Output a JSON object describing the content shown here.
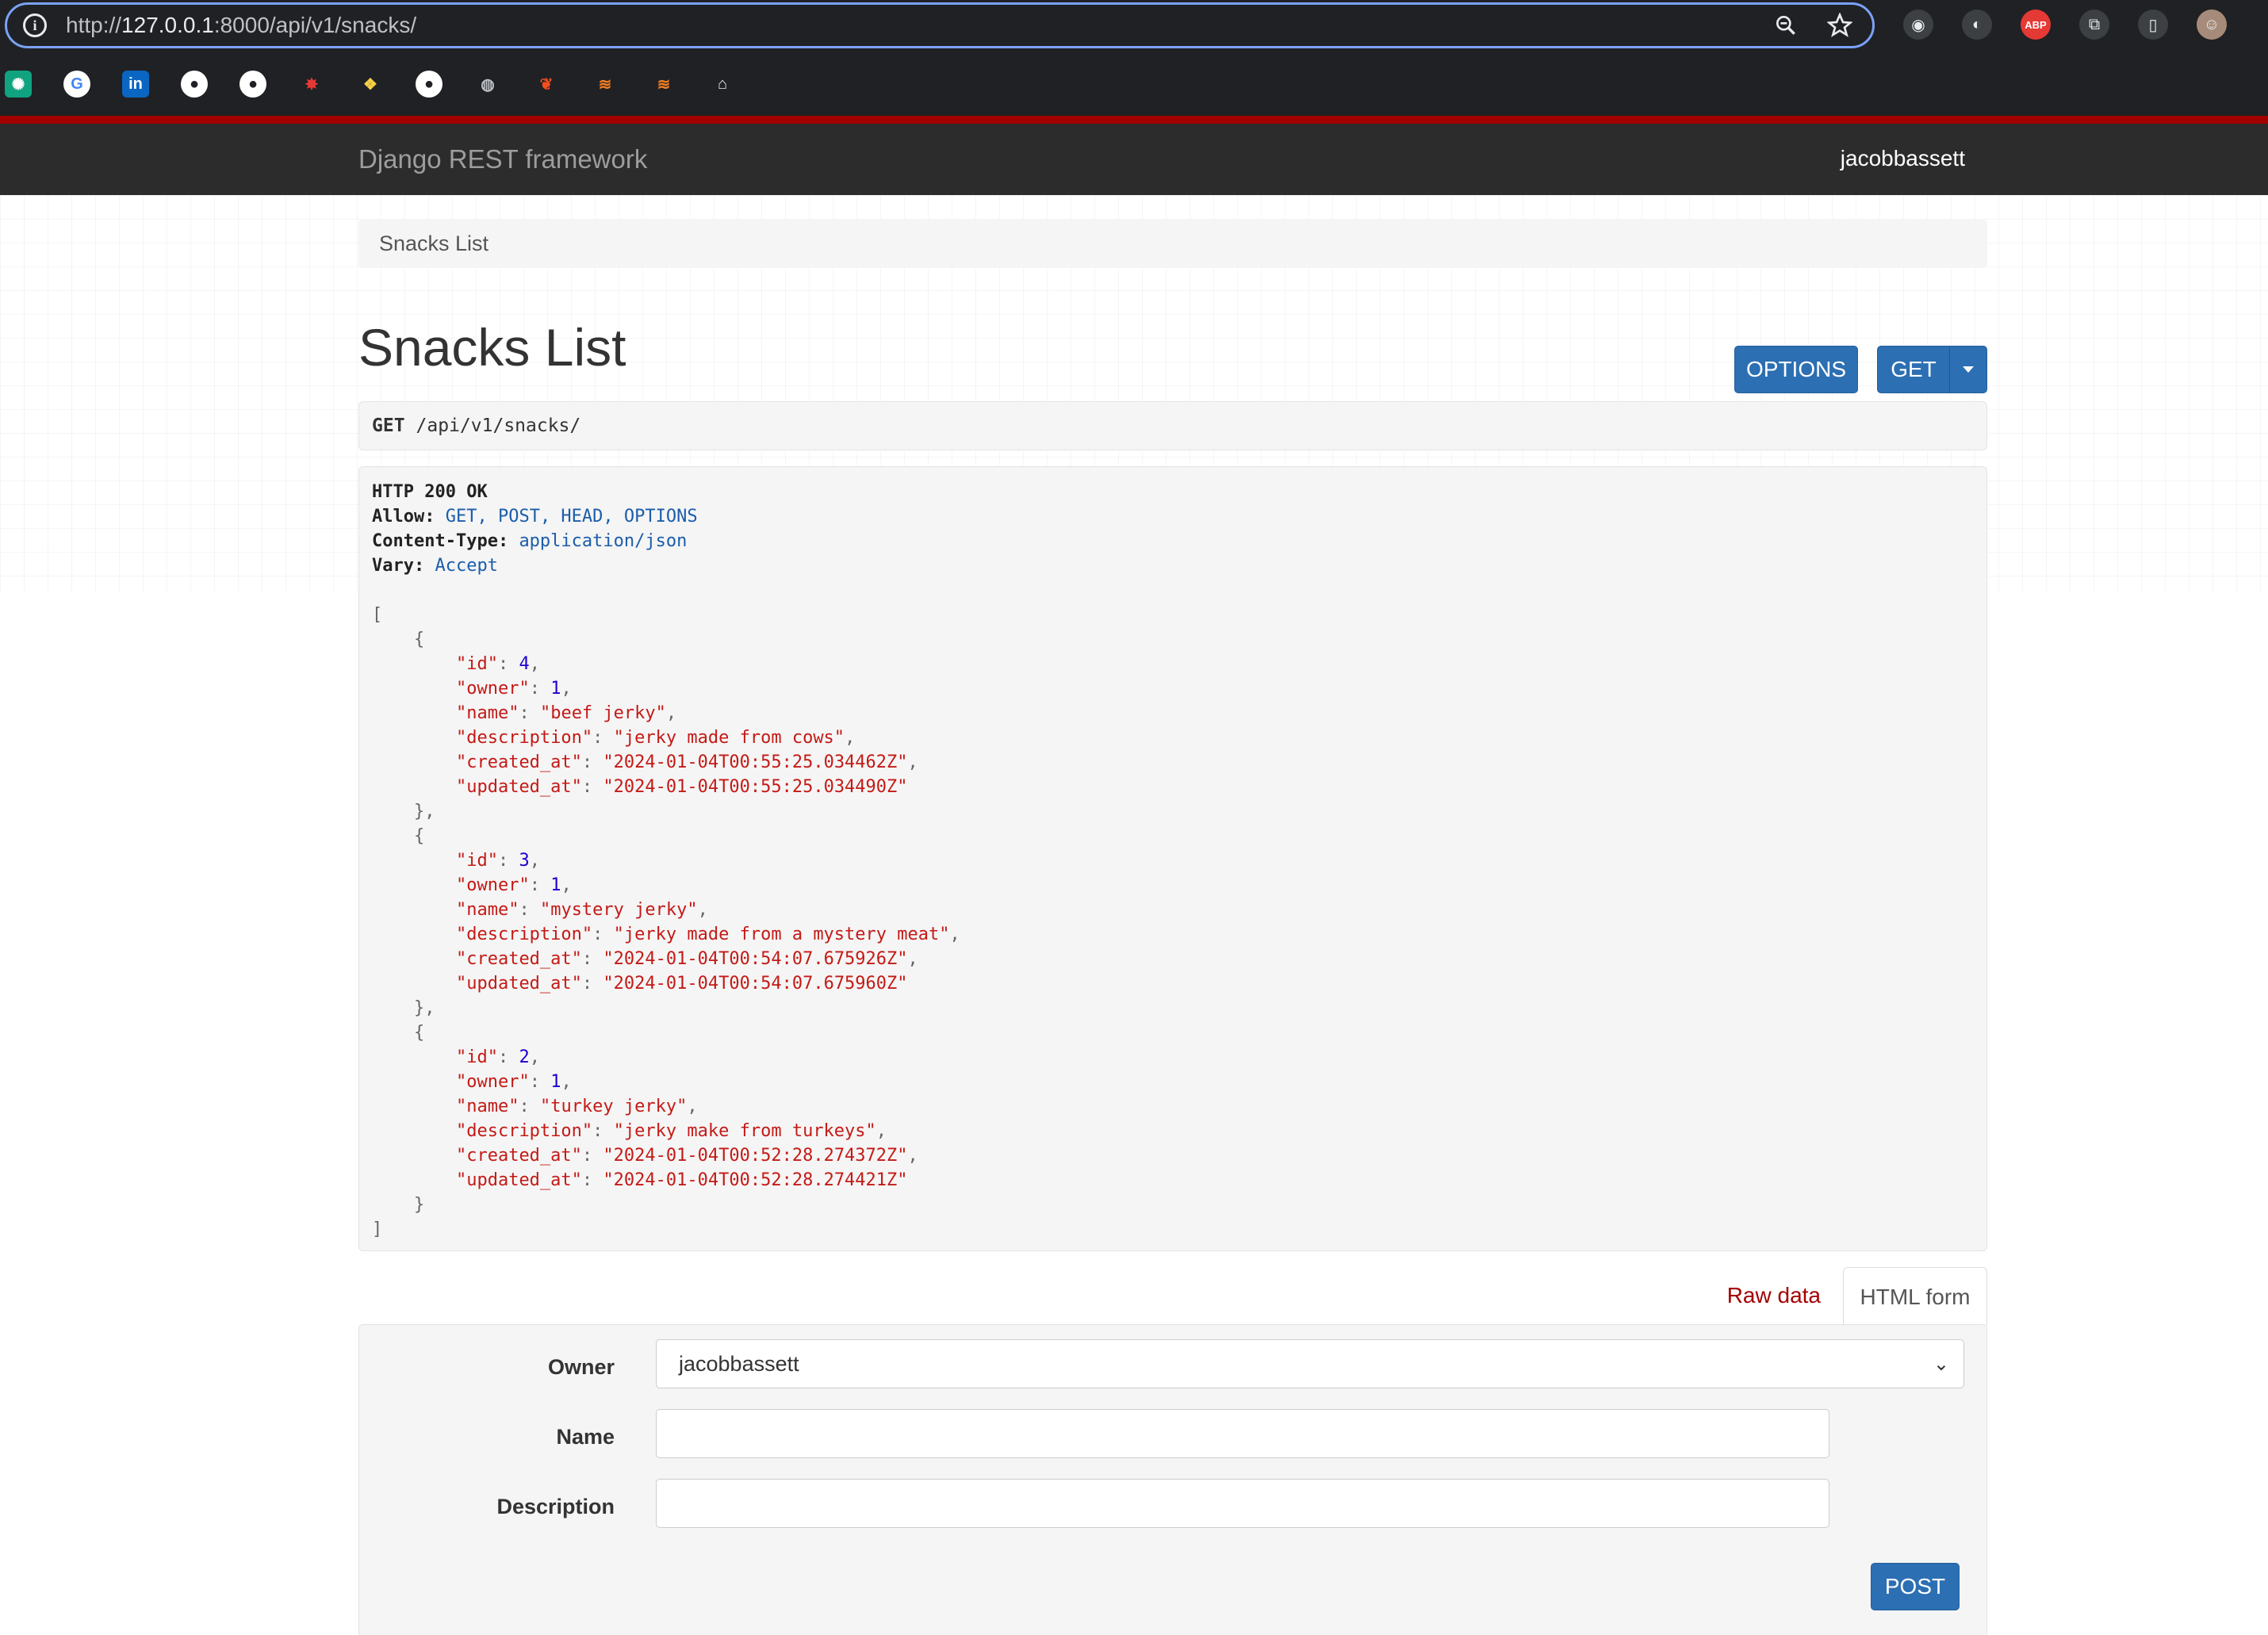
{
  "browser": {
    "url_prefix": "http://",
    "url_host": "127.0.0.1",
    "url_rest": ":8000/api/v1/snacks/"
  },
  "navbar": {
    "brand": "Django REST framework",
    "user": "jacobbassett"
  },
  "breadcrumb": "Snacks List",
  "page_title": "Snacks List",
  "buttons": {
    "options": "OPTIONS",
    "get": "GET",
    "post": "POST"
  },
  "request": {
    "method": "GET",
    "path": "/api/v1/snacks/"
  },
  "response": {
    "status_line": "HTTP 200 OK",
    "headers": [
      {
        "key": "Allow:",
        "value": "GET, POST, HEAD, OPTIONS"
      },
      {
        "key": "Content-Type:",
        "value": "application/json"
      },
      {
        "key": "Vary:",
        "value": "Accept"
      }
    ],
    "items": [
      {
        "id": 4,
        "owner": 1,
        "name": "beef jerky",
        "description": "jerky made from cows",
        "created_at": "2024-01-04T00:55:25.034462Z",
        "updated_at": "2024-01-04T00:55:25.034490Z"
      },
      {
        "id": 3,
        "owner": 1,
        "name": "mystery jerky",
        "description": "jerky made from a mystery meat",
        "created_at": "2024-01-04T00:54:07.675926Z",
        "updated_at": "2024-01-04T00:54:07.675960Z"
      },
      {
        "id": 2,
        "owner": 1,
        "name": "turkey jerky",
        "description": "jerky make from turkeys",
        "created_at": "2024-01-04T00:52:28.274372Z",
        "updated_at": "2024-01-04T00:52:28.274421Z"
      }
    ]
  },
  "tabs": {
    "raw": "Raw data",
    "html": "HTML form"
  },
  "form": {
    "owner_label": "Owner",
    "owner_value": "jacobbassett",
    "name_label": "Name",
    "name_value": "",
    "description_label": "Description",
    "description_value": ""
  },
  "colors": {
    "accent": "#2c6fb3",
    "navbar": "#2c2c2c",
    "brand_red": "#a30000"
  }
}
